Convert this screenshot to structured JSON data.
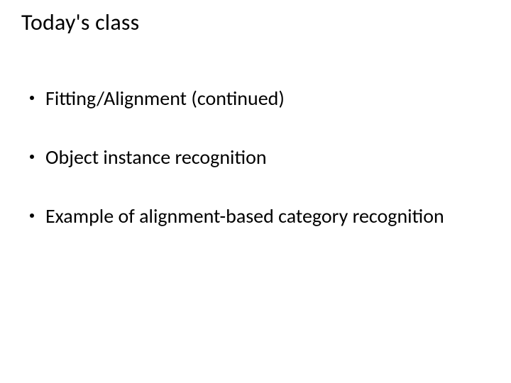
{
  "slide": {
    "title": "Today's class",
    "bullets": [
      "Fitting/Alignment (continued)",
      "Object instance recognition",
      "Example of alignment-based category recognition"
    ]
  }
}
